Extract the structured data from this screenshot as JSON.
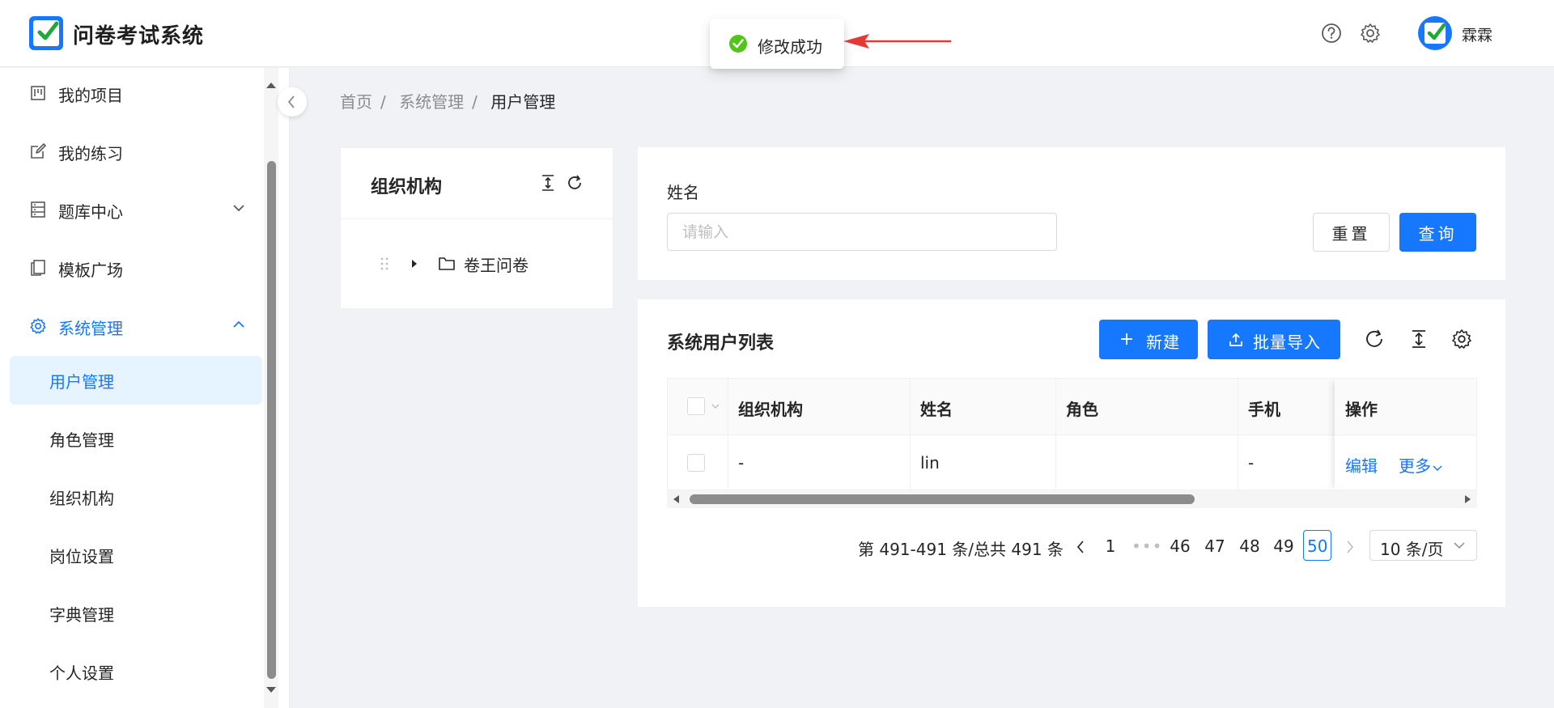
{
  "app": {
    "title": "问卷考试系统"
  },
  "header": {
    "username": "霖霖",
    "help_icon": "question-circle-icon",
    "settings_icon": "gear-icon"
  },
  "toast": {
    "message": "修改成功",
    "icon": "check-circle-icon",
    "color": "#52c41a"
  },
  "colors": {
    "primary": "#1677ff",
    "active_bg": "#e6f4ff",
    "arrow": "#e53935"
  },
  "sidebar": {
    "items": [
      {
        "label": "我的项目",
        "icon": "project-icon"
      },
      {
        "label": "我的练习",
        "icon": "edit-icon"
      },
      {
        "label": "题库中心",
        "icon": "database-icon",
        "expandable": true
      },
      {
        "label": "模板广场",
        "icon": "copy-icon"
      },
      {
        "label": "系统管理",
        "icon": "gear-icon",
        "expanded": true
      }
    ],
    "sub_items": [
      {
        "label": "用户管理",
        "selected": true
      },
      {
        "label": "角色管理"
      },
      {
        "label": "组织机构"
      },
      {
        "label": "岗位设置"
      },
      {
        "label": "字典管理"
      },
      {
        "label": "个人设置"
      }
    ]
  },
  "breadcrumb": [
    "首页",
    "系统管理",
    "用户管理"
  ],
  "org_panel": {
    "title": "组织机构",
    "tree": [
      {
        "label": "卷王问卷",
        "icon": "folder-icon"
      }
    ]
  },
  "search": {
    "field_label": "姓名",
    "placeholder": "请输入",
    "value": "",
    "reset_label": "重置",
    "query_label": "查询"
  },
  "user_list": {
    "title": "系统用户列表",
    "new_label": "新建",
    "import_label": "批量导入",
    "columns": [
      "组织机构",
      "姓名",
      "角色",
      "手机",
      "操作"
    ],
    "rows": [
      {
        "org": "-",
        "name": "lin",
        "role": "",
        "phone": "-",
        "edit": "编辑",
        "more": "更多"
      }
    ]
  },
  "pagination": {
    "total_text": "第 491-491 条/总共 491 条",
    "pages": [
      "1",
      "46",
      "47",
      "48",
      "49",
      "50"
    ],
    "current": "50",
    "page_size": "10 条/页"
  }
}
